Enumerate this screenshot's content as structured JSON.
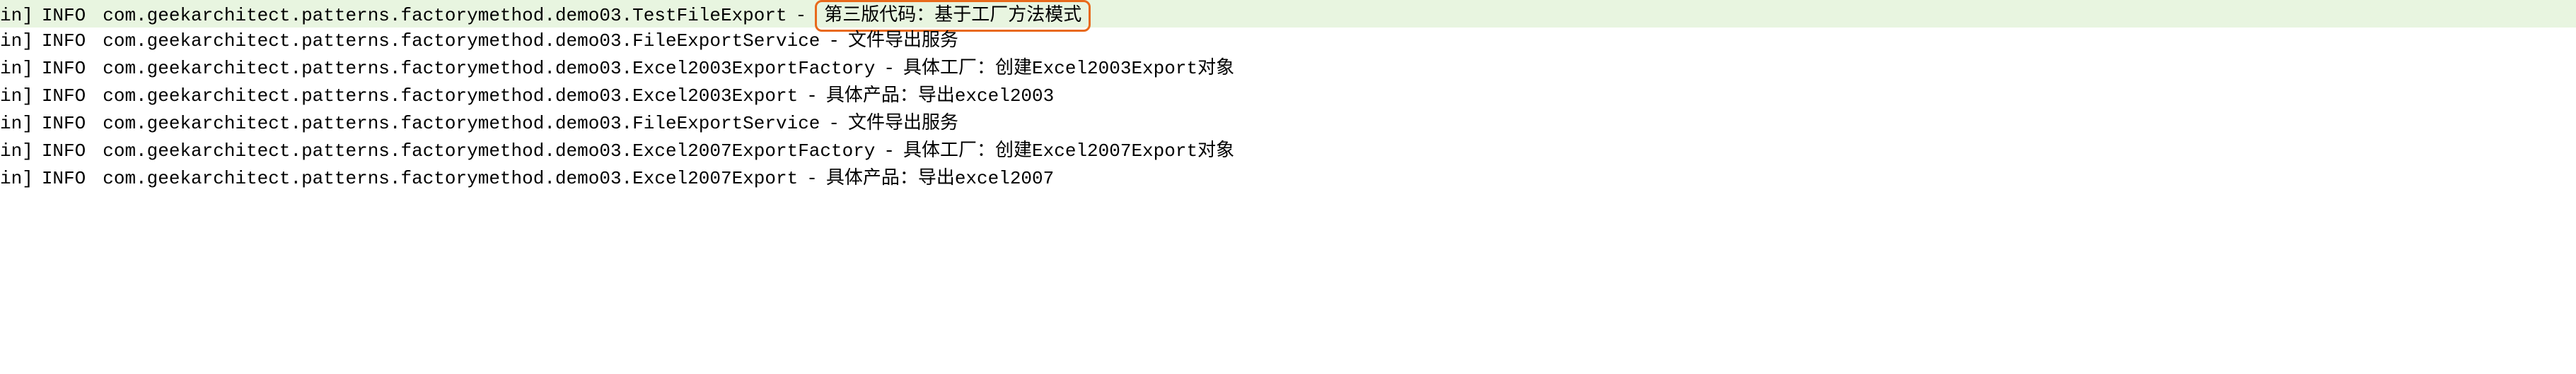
{
  "log_lines": [
    {
      "prefix": "in]",
      "level": "INFO",
      "classname": "com.geekarchitect.patterns.factorymethod.demo03.TestFileExport",
      "separator": "-",
      "message": "第三版代码：基于工厂方法模式",
      "highlighted": true
    },
    {
      "prefix": "in]",
      "level": "INFO",
      "classname": "com.geekarchitect.patterns.factorymethod.demo03.FileExportService",
      "separator": "-",
      "message": "文件导出服务",
      "highlighted": false
    },
    {
      "prefix": "in]",
      "level": "INFO",
      "classname": "com.geekarchitect.patterns.factorymethod.demo03.Excel2003ExportFactory",
      "separator": "-",
      "message": "具体工厂：创建Excel2003Export对象",
      "highlighted": false
    },
    {
      "prefix": "in]",
      "level": "INFO",
      "classname": "com.geekarchitect.patterns.factorymethod.demo03.Excel2003Export",
      "separator": "-",
      "message": "具体产品：导出excel2003",
      "highlighted": false
    },
    {
      "prefix": "in]",
      "level": "INFO",
      "classname": "com.geekarchitect.patterns.factorymethod.demo03.FileExportService",
      "separator": "-",
      "message": "文件导出服务",
      "highlighted": false
    },
    {
      "prefix": "in]",
      "level": "INFO",
      "classname": "com.geekarchitect.patterns.factorymethod.demo03.Excel2007ExportFactory",
      "separator": "-",
      "message": "具体工厂：创建Excel2007Export对象",
      "highlighted": false
    },
    {
      "prefix": "in]",
      "level": "INFO",
      "classname": "com.geekarchitect.patterns.factorymethod.demo03.Excel2007Export",
      "separator": "-",
      "message": "具体产品：导出excel2007",
      "highlighted": false
    }
  ]
}
